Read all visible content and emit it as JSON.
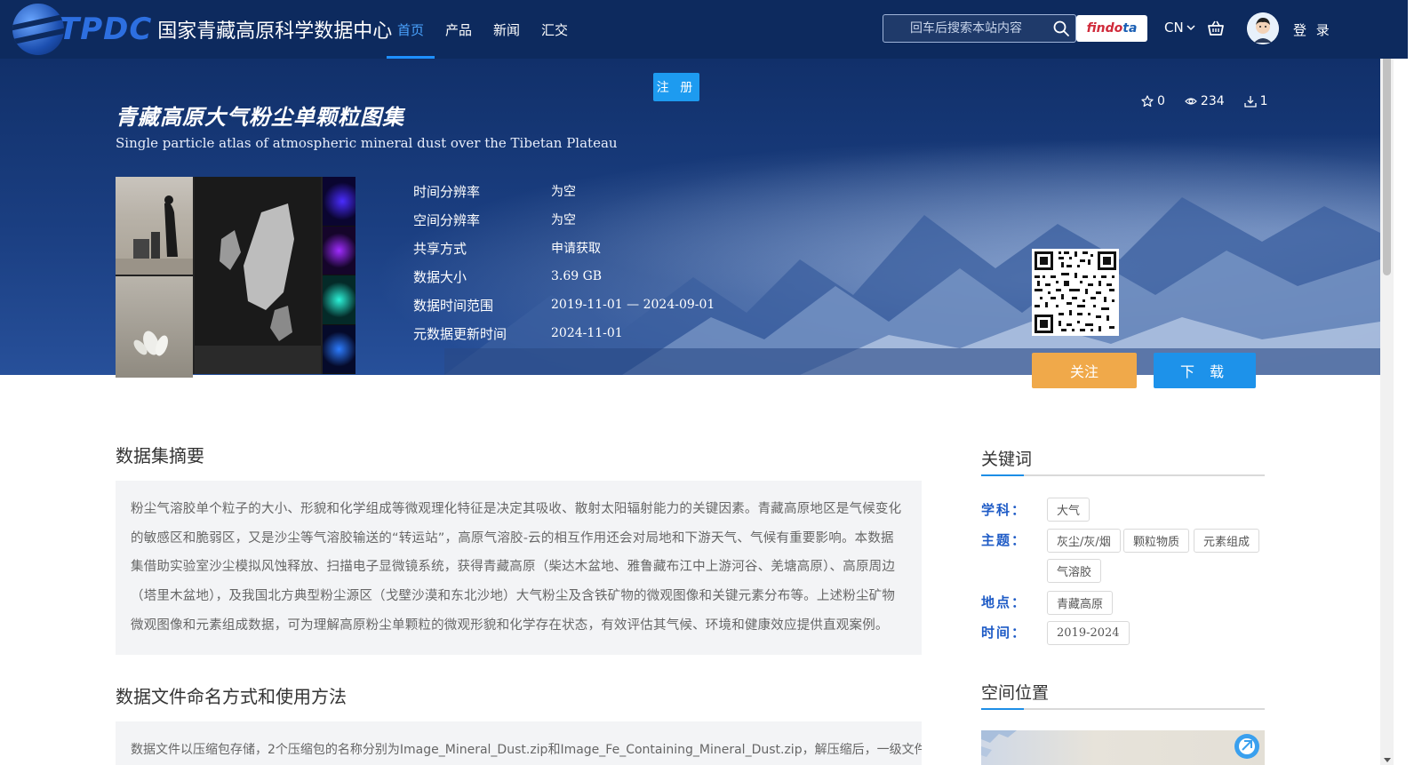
{
  "header": {
    "logo_text": "TPDC",
    "site_name": "国家青藏高原科学数据中心",
    "nav": [
      {
        "label": "首页",
        "active": true
      },
      {
        "label": "产品",
        "active": false
      },
      {
        "label": "新闻",
        "active": false
      },
      {
        "label": "汇交",
        "active": false
      }
    ],
    "search_placeholder": "回车后搜索本站内容",
    "findata_label_a": "findo",
    "findata_label_b": "ta",
    "lang": "CN",
    "login_label": "登 录",
    "register_label": "注 册"
  },
  "dataset": {
    "title_cn": "青藏高原大气粉尘单颗粒图集",
    "title_en": "Single particle atlas of atmospheric mineral dust over the Tibetan Plateau",
    "stats": {
      "stars": "0",
      "views": "234",
      "downloads": "1"
    },
    "meta": [
      {
        "label": "时间分辨率",
        "value": "为空"
      },
      {
        "label": "空间分辨率",
        "value": "为空"
      },
      {
        "label": "共享方式",
        "value": "申请获取"
      },
      {
        "label": "数据大小",
        "value": "3.69 GB"
      },
      {
        "label": "数据时间范围",
        "value": "2019-11-01 — 2024-09-01"
      },
      {
        "label": "元数据更新时间",
        "value": "2024-11-01"
      }
    ],
    "follow_label": "关注",
    "download_label": "下 载"
  },
  "abstract": {
    "title": "数据集摘要",
    "text": "粉尘气溶胶单个粒子的大小、形貌和化学组成等微观理化特征是决定其吸收、散射太阳辐射能力的关键因素。青藏高原地区是气候变化的敏感区和脆弱区，又是沙尘等气溶胶输送的“转运站”，高原气溶胶-云的相互作用还会对局地和下游天气、气候有重要影响。本数据集借助实验室沙尘模拟风蚀释放、扫描电子显微镜系统，获得青藏高原（柴达木盆地、雅鲁藏布江中上游河谷、羌塘高原）、高原周边（塔里木盆地），及我国北方典型粉尘源区（戈壁沙漠和东北沙地）大气粉尘及含铁矿物的微观图像和关键元素分布等。上述粉尘矿物微观图像和元素组成数据，可为理解高原粉尘单颗粒的微观形貌和化学存在状态，有效评估其气候、环境和健康效应提供直观案例。"
  },
  "usage": {
    "title": "数据文件命名方式和使用方法",
    "text": "数据文件以压缩包存储，2个压缩包的名称分别为Image_Mineral_Dust.zip和Image_Fe_Containing_Mineral_Dust.zip，解压缩后，一级文件"
  },
  "keywords": {
    "title": "关键词",
    "groups": [
      {
        "label": "学科：",
        "tags": [
          "大气"
        ]
      },
      {
        "label": "主题：",
        "tags": [
          "灰尘/灰/烟",
          "颗粒物质",
          "元素组成",
          "气溶胶"
        ]
      },
      {
        "label": "地点：",
        "tags": [
          "青藏高原"
        ]
      },
      {
        "label": "时间：",
        "tags": [
          "2019-2024"
        ]
      }
    ]
  },
  "spatial": {
    "title": "空间位置"
  },
  "colors": {
    "header_bg": "#0d2a5e",
    "accent": "#1d92ea",
    "follow": "#f0a94a",
    "keyword_label": "#1e5bc6"
  }
}
